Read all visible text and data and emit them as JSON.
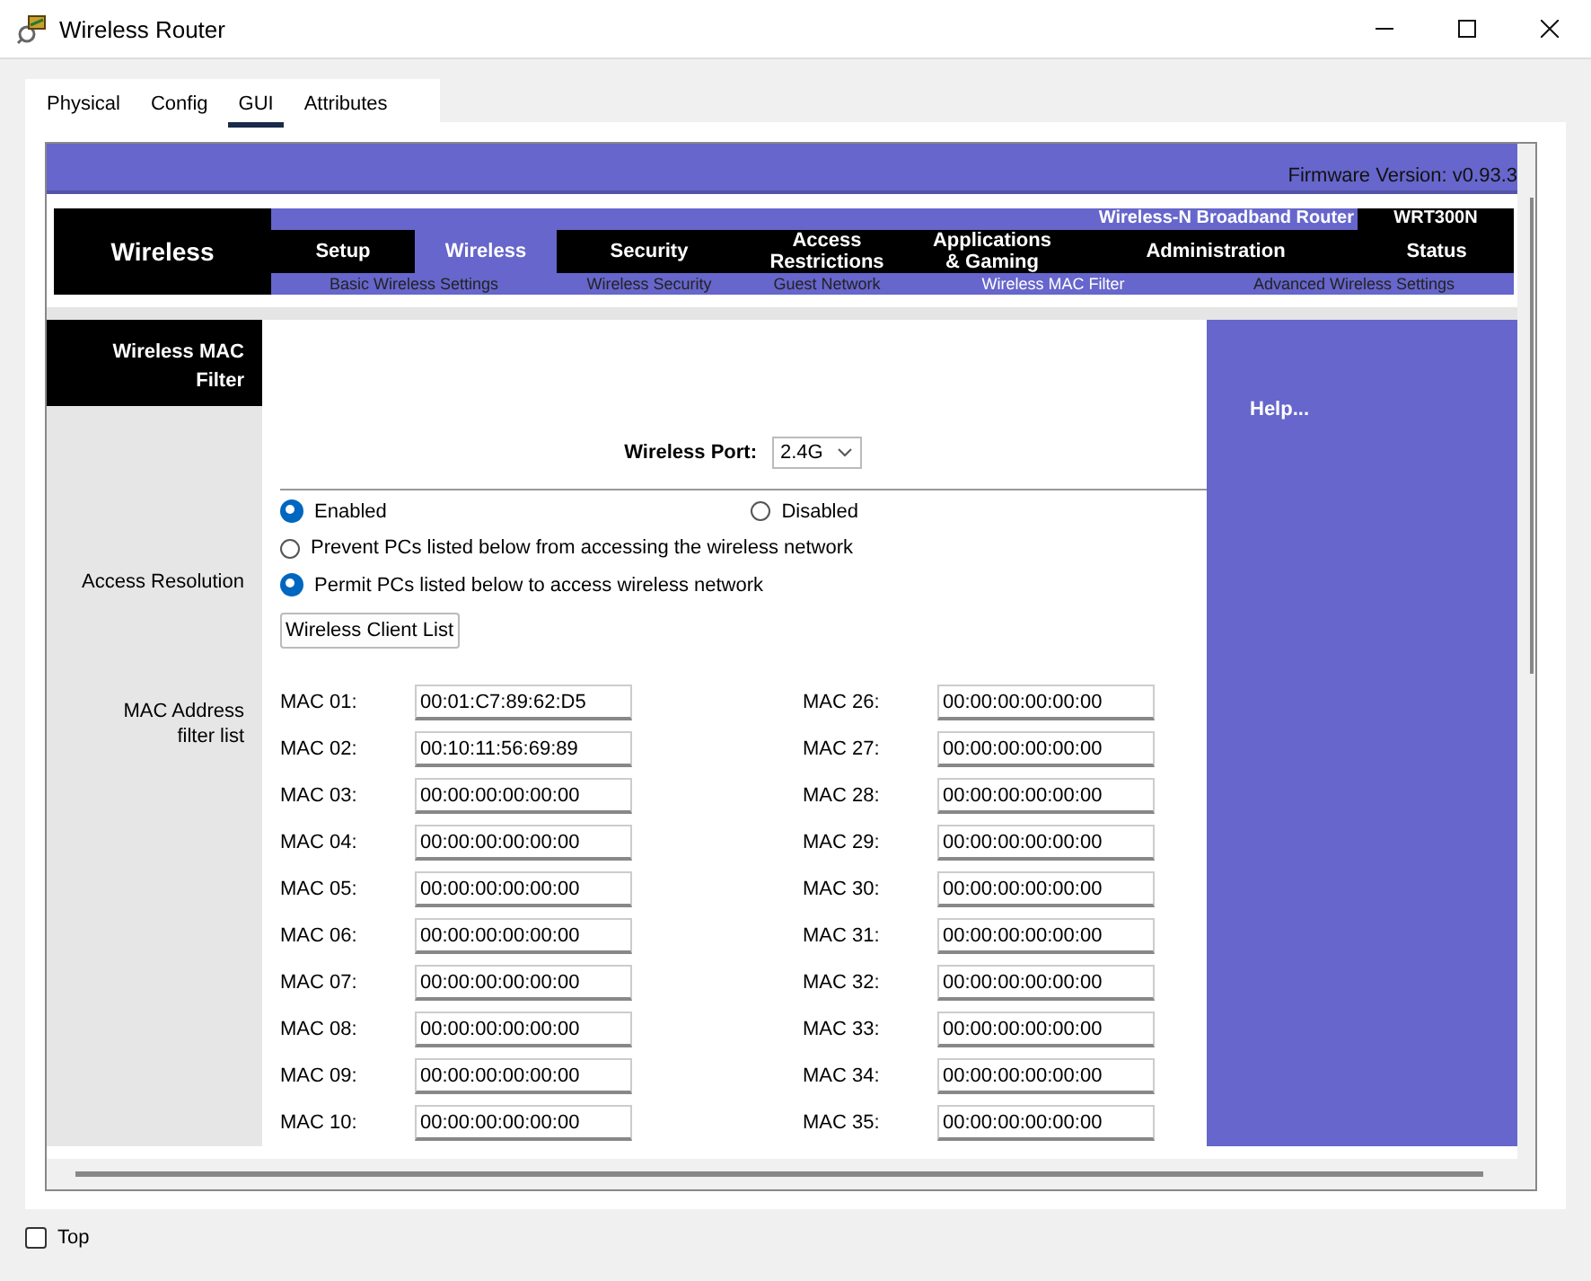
{
  "window": {
    "title": "Wireless Router"
  },
  "tabs": [
    {
      "label": "Physical",
      "selected": false
    },
    {
      "label": "Config",
      "selected": false
    },
    {
      "label": "GUI",
      "selected": true
    },
    {
      "label": "Attributes",
      "selected": false
    }
  ],
  "router": {
    "firmware": "Firmware Version: v0.93.3",
    "section": "Wireless",
    "product": "Wireless-N Broadband Router",
    "model": "WRT300N",
    "menu": [
      {
        "label": "Setup",
        "selected": false
      },
      {
        "label": "Wireless",
        "selected": true
      },
      {
        "label": "Security",
        "selected": false
      },
      {
        "label": "Access Restrictions",
        "selected": false
      },
      {
        "label": "Applications & Gaming",
        "selected": false
      },
      {
        "label": "Administration",
        "selected": false
      },
      {
        "label": "Status",
        "selected": false
      }
    ],
    "submenu": [
      {
        "label": "Basic Wireless Settings",
        "selected": false
      },
      {
        "label": "Wireless Security",
        "selected": false
      },
      {
        "label": "Guest Network",
        "selected": false
      },
      {
        "label": "Wireless MAC Filter",
        "selected": true
      },
      {
        "label": "Advanced Wireless Settings",
        "selected": false
      }
    ],
    "panel_title": "Wireless MAC Filter",
    "port": {
      "label": "Wireless Port:",
      "value": "2.4G"
    },
    "access_label": "Access Resolution",
    "mode": [
      {
        "label": "Enabled",
        "selected": true
      },
      {
        "label": "Disabled",
        "selected": false
      }
    ],
    "policy": [
      {
        "label": "Prevent PCs listed below from accessing the wireless network",
        "selected": false
      },
      {
        "label": "Permit PCs listed below to access wireless network",
        "selected": true
      }
    ],
    "client_list_button": "Wireless Client List",
    "mac_label": "MAC Address filter list",
    "mac_columns": [
      {
        "entries": [
          {
            "label": "MAC 01:",
            "value": "00:01:C7:89:62:D5"
          },
          {
            "label": "MAC 02:",
            "value": "00:10:11:56:69:89"
          },
          {
            "label": "MAC 03:",
            "value": "00:00:00:00:00:00"
          },
          {
            "label": "MAC 04:",
            "value": "00:00:00:00:00:00"
          },
          {
            "label": "MAC 05:",
            "value": "00:00:00:00:00:00"
          },
          {
            "label": "MAC 06:",
            "value": "00:00:00:00:00:00"
          },
          {
            "label": "MAC 07:",
            "value": "00:00:00:00:00:00"
          },
          {
            "label": "MAC 08:",
            "value": "00:00:00:00:00:00"
          },
          {
            "label": "MAC 09:",
            "value": "00:00:00:00:00:00"
          },
          {
            "label": "MAC 10:",
            "value": "00:00:00:00:00:00"
          }
        ]
      },
      {
        "entries": [
          {
            "label": "MAC 26:",
            "value": "00:00:00:00:00:00"
          },
          {
            "label": "MAC 27:",
            "value": "00:00:00:00:00:00"
          },
          {
            "label": "MAC 28:",
            "value": "00:00:00:00:00:00"
          },
          {
            "label": "MAC 29:",
            "value": "00:00:00:00:00:00"
          },
          {
            "label": "MAC 30:",
            "value": "00:00:00:00:00:00"
          },
          {
            "label": "MAC 31:",
            "value": "00:00:00:00:00:00"
          },
          {
            "label": "MAC 32:",
            "value": "00:00:00:00:00:00"
          },
          {
            "label": "MAC 33:",
            "value": "00:00:00:00:00:00"
          },
          {
            "label": "MAC 34:",
            "value": "00:00:00:00:00:00"
          },
          {
            "label": "MAC 35:",
            "value": "00:00:00:00:00:00"
          }
        ]
      }
    ],
    "help": "Help..."
  },
  "top_checkbox": {
    "label": "Top",
    "checked": false
  }
}
